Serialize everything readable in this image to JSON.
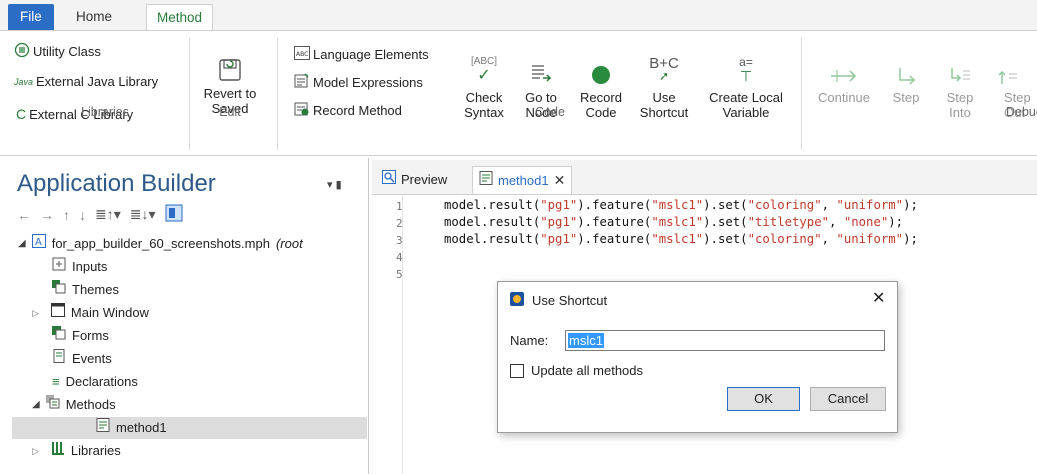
{
  "ribbon": {
    "tabs": [
      "File",
      "Home",
      "Method"
    ],
    "libraries": {
      "items": [
        "Utility Class",
        "External Java Library",
        "External C Library"
      ],
      "java_prefix": "Java",
      "label": "Libraries"
    },
    "edit": {
      "revert": "Revert to Saved",
      "label": "Edit"
    },
    "code": {
      "items": [
        "Language Elements",
        "Model Expressions",
        "Record Method"
      ],
      "check_syntax": "Check Syntax",
      "goto_node": "Go to Node",
      "record_code": "Record Code",
      "use_shortcut": "Use Shortcut",
      "create_local": "Create Local Variable",
      "label": "Code",
      "abc_text": "[ABC]",
      "bc_text": "B+C",
      "a_eq": "a="
    },
    "debug": {
      "continue": "Continue",
      "step": "Step",
      "step_into": "Step Into",
      "step_out": "Step Out",
      "label": "Debug"
    }
  },
  "left": {
    "title": "Application Builder",
    "root": "for_app_builder_60_screenshots.mph",
    "root_suffix": "(root",
    "items": [
      "Inputs",
      "Themes",
      "Main Window",
      "Forms",
      "Events",
      "Declarations",
      "Methods",
      "method1",
      "Libraries"
    ]
  },
  "editor": {
    "tabs": [
      "Preview",
      "method1"
    ],
    "line_numbers": [
      "1",
      "2",
      "3",
      "4",
      "5"
    ],
    "lines": [
      [
        "model.result(",
        "\"pg1\"",
        ").feature(",
        "\"mslc1\"",
        ").set(",
        "\"coloring\"",
        ", ",
        "\"uniform\"",
        ");"
      ],
      [
        "model.result(",
        "\"pg1\"",
        ").feature(",
        "\"mslc1\"",
        ").set(",
        "\"titletype\"",
        ", ",
        "\"none\"",
        ");"
      ],
      [
        "model.result(",
        "\"pg1\"",
        ").feature(",
        "\"mslc1\"",
        ").set(",
        "\"coloring\"",
        ", ",
        "\"uniform\"",
        ");"
      ]
    ]
  },
  "dialog": {
    "title": "Use Shortcut",
    "name_label": "Name:",
    "name_value": "mslc1",
    "checkbox_label": "Update all methods",
    "ok": "OK",
    "cancel": "Cancel"
  },
  "colors": {
    "accent": "#2b6cc4",
    "method_tab": "#2a7a3a",
    "string": "#c0392b"
  }
}
